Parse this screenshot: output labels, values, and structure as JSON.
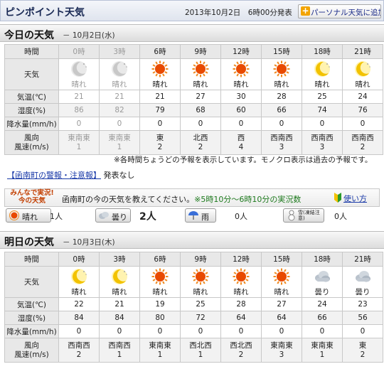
{
  "header": {
    "title": "ピンポイント天気",
    "issued": "2013年10月2日　6時00分発表",
    "add_button": "パーソナル天気に追加",
    "add_icon": "plus-icon"
  },
  "today": {
    "heading": "今日の天気",
    "date": "－ 10月2日(水)",
    "labels": {
      "time": "時間",
      "weather": "天気",
      "temp": "気温(℃)",
      "humidity": "湿度(%)",
      "precip": "降水量(mm/h)",
      "wind_dir": "風向",
      "wind_speed": "風速(m/s)"
    },
    "columns": [
      {
        "time": "0時",
        "cond": "晴れ",
        "icon": "moon",
        "temp": "21",
        "hum": "86",
        "precip": "0",
        "dir": "東南東",
        "speed": "1",
        "past": true
      },
      {
        "time": "3時",
        "cond": "晴れ",
        "icon": "moon",
        "temp": "21",
        "hum": "82",
        "precip": "0",
        "dir": "東南東",
        "speed": "1",
        "past": true
      },
      {
        "time": "6時",
        "cond": "晴れ",
        "icon": "sun",
        "temp": "21",
        "hum": "79",
        "precip": "0",
        "dir": "東",
        "speed": "2",
        "past": false
      },
      {
        "time": "9時",
        "cond": "晴れ",
        "icon": "sun",
        "temp": "27",
        "hum": "68",
        "precip": "0",
        "dir": "北西",
        "speed": "2",
        "past": false
      },
      {
        "time": "12時",
        "cond": "晴れ",
        "icon": "sun",
        "temp": "30",
        "hum": "60",
        "precip": "0",
        "dir": "西",
        "speed": "4",
        "past": false
      },
      {
        "time": "15時",
        "cond": "晴れ",
        "icon": "sun",
        "temp": "28",
        "hum": "66",
        "precip": "0",
        "dir": "西南西",
        "speed": "3",
        "past": false
      },
      {
        "time": "18時",
        "cond": "晴れ",
        "icon": "moon-yellow",
        "temp": "25",
        "hum": "74",
        "precip": "0",
        "dir": "西南西",
        "speed": "3",
        "past": false
      },
      {
        "time": "21時",
        "cond": "晴れ",
        "icon": "moon-yellow",
        "temp": "24",
        "hum": "76",
        "precip": "0",
        "dir": "西南西",
        "speed": "2",
        "past": false
      }
    ],
    "note": "※各時間ちょうどの予報を表示しています。モノクロ表示は過去の予報です。"
  },
  "warning": {
    "link": "【函南町の警報・注意報】",
    "text": "発表なし"
  },
  "minna": {
    "logo": "みんなで実況! 今の天気",
    "question": "函南町の今の天気を教えてください。",
    "time_range": "※5時10分～6時10分の実況数",
    "help": "使い方",
    "help_icon": "beginner-mark-icon",
    "votes": [
      {
        "label": "晴れ",
        "count": "1人",
        "icon": "sun-icon"
      },
      {
        "label": "曇り",
        "count": "2人",
        "icon": "cloud-icon"
      },
      {
        "label": "雨",
        "count": "0人",
        "icon": "umbrella-icon"
      },
      {
        "label": "雪(凍結注意)",
        "count": "0人",
        "icon": "snowman-icon"
      }
    ]
  },
  "tomorrow": {
    "heading": "明日の天気",
    "date": "－ 10月3日(木)",
    "labels": {
      "time": "時間",
      "weather": "天気",
      "temp": "気温(℃)",
      "humidity": "湿度(%)",
      "precip": "降水量(mm/h)",
      "wind_dir": "風向",
      "wind_speed": "風速(m/s)"
    },
    "columns": [
      {
        "time": "0時",
        "cond": "晴れ",
        "icon": "moon-yellow",
        "temp": "22",
        "hum": "84",
        "precip": "0",
        "dir": "西南西",
        "speed": "2"
      },
      {
        "time": "3時",
        "cond": "晴れ",
        "icon": "moon-yellow",
        "temp": "21",
        "hum": "84",
        "precip": "0",
        "dir": "西南西",
        "speed": "1"
      },
      {
        "time": "6時",
        "cond": "晴れ",
        "icon": "sun",
        "temp": "19",
        "hum": "80",
        "precip": "0",
        "dir": "東南東",
        "speed": "1"
      },
      {
        "time": "9時",
        "cond": "晴れ",
        "icon": "sun",
        "temp": "25",
        "hum": "72",
        "precip": "0",
        "dir": "西北西",
        "speed": "1"
      },
      {
        "time": "12時",
        "cond": "晴れ",
        "icon": "sun",
        "temp": "28",
        "hum": "64",
        "precip": "0",
        "dir": "西北西",
        "speed": "2"
      },
      {
        "time": "15時",
        "cond": "晴れ",
        "icon": "sun",
        "temp": "27",
        "hum": "64",
        "precip": "0",
        "dir": "東南東",
        "speed": "3"
      },
      {
        "time": "18時",
        "cond": "曇り",
        "icon": "cloud",
        "temp": "24",
        "hum": "66",
        "precip": "0",
        "dir": "東南東",
        "speed": "1"
      },
      {
        "time": "21時",
        "cond": "曇り",
        "icon": "cloud",
        "temp": "23",
        "hum": "56",
        "precip": "0",
        "dir": "東",
        "speed": "2"
      }
    ]
  }
}
